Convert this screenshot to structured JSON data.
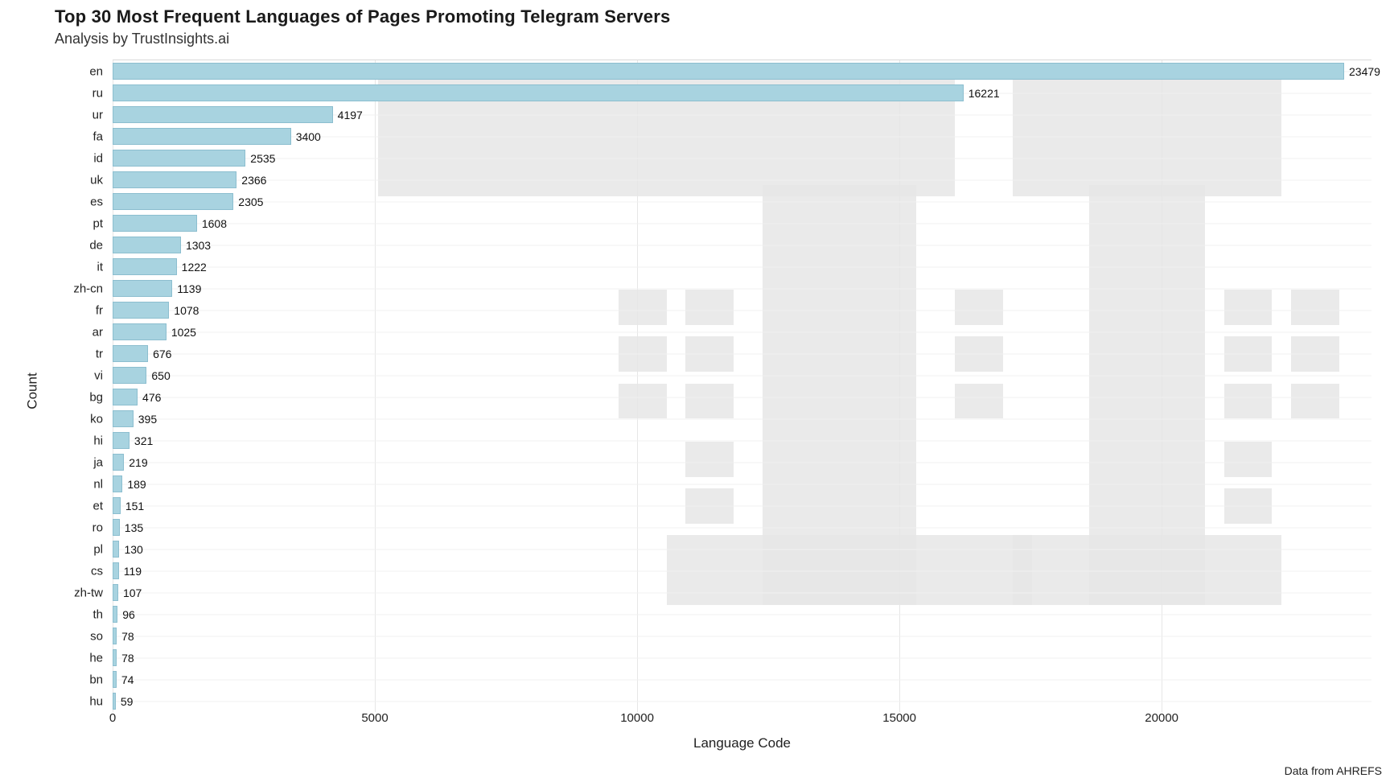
{
  "chart_data": {
    "type": "bar",
    "orientation": "horizontal",
    "title": "Top 30 Most Frequent Languages of Pages Promoting Telegram Servers",
    "subtitle": "Analysis by TrustInsights.ai",
    "xlabel": "Language Code",
    "ylabel": "Count",
    "caption": "Data from AHREFS",
    "xlim": [
      0,
      24000
    ],
    "x_ticks": [
      0,
      5000,
      10000,
      15000,
      20000
    ],
    "categories": [
      "en",
      "ru",
      "ur",
      "fa",
      "id",
      "uk",
      "es",
      "pt",
      "de",
      "it",
      "zh-cn",
      "fr",
      "ar",
      "tr",
      "vi",
      "bg",
      "ko",
      "hi",
      "ja",
      "nl",
      "et",
      "ro",
      "pl",
      "cs",
      "zh-tw",
      "th",
      "so",
      "he",
      "bn",
      "hu"
    ],
    "values": [
      23479,
      16221,
      4197,
      3400,
      2535,
      2366,
      2305,
      1608,
      1303,
      1222,
      1139,
      1078,
      1025,
      676,
      650,
      476,
      395,
      321,
      219,
      189,
      151,
      135,
      130,
      119,
      107,
      96,
      78,
      78,
      74,
      59
    ],
    "bar_fill": "#a8d3e0"
  }
}
